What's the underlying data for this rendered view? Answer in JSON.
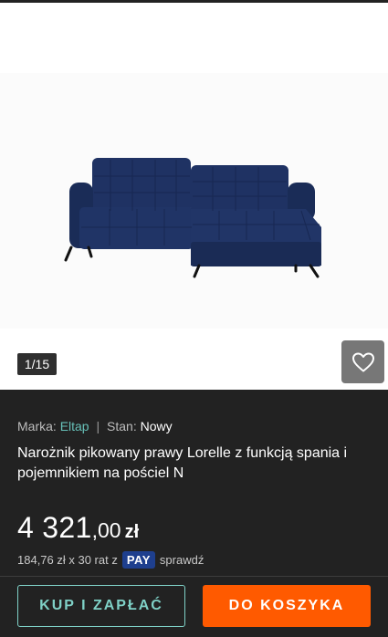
{
  "gallery": {
    "counter": "1/15",
    "image_alt": "sofa-product-image",
    "favorite_icon": "heart-outline-icon"
  },
  "product": {
    "brand_label": "Marka:",
    "brand_value": "Eltap",
    "condition_label": "Stan:",
    "condition_value": "Nowy",
    "title": "Narożnik pikowany prawy Lorelle z funkcją spania i pojemnikiem na pościel N",
    "price_int": "4 321",
    "price_dec": ",00",
    "currency": "zł",
    "installments_text": "184,76 zł x 30 rat z",
    "pay_badge": "PAY",
    "check_link": "sprawdź"
  },
  "actions": {
    "buy_label": "KUP I ZAPŁAĆ",
    "cart_label": "DO KOSZYKA"
  },
  "colors": {
    "accent_teal": "#7fd1c7",
    "cart_orange": "#ff5a00",
    "pay_blue": "#1e3f8e",
    "sofa_navy": "#1c2d5a",
    "background": "#222222"
  }
}
